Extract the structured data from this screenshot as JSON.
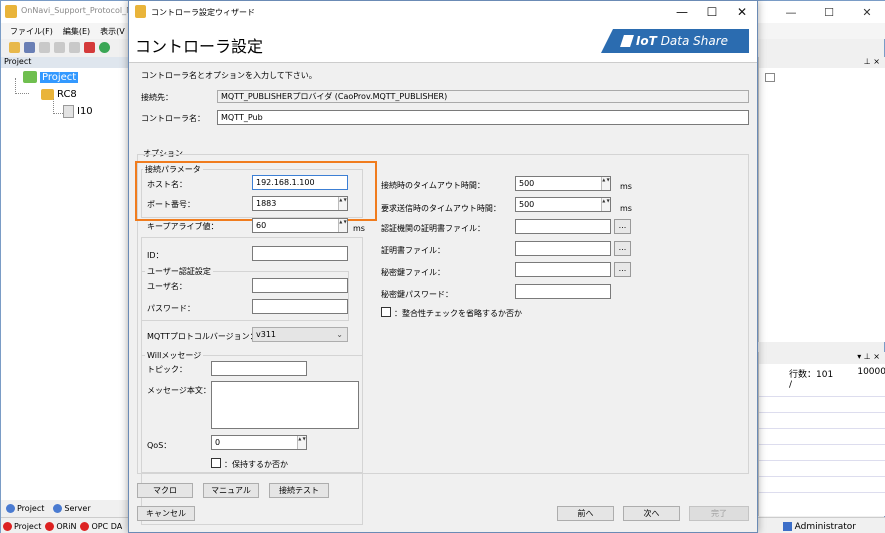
{
  "background_app": {
    "title": "OnNavi_Support_Protocol_M",
    "menu": [
      "ファイル(F)",
      "編集(E)",
      "表示(V"
    ],
    "project_panel_title": "Project",
    "tree": {
      "root": "Project",
      "child": "RC8",
      "grandchild": "I10"
    },
    "bottom_tabs": [
      "Project",
      "Server"
    ],
    "status_items": [
      "Project",
      "ORiN",
      "OPC DA"
    ],
    "admin_label": "Administrator",
    "row_count_label": "行数：101 /",
    "row_count_max": "10000",
    "window_controls": [
      "—",
      "☐",
      "✕"
    ],
    "pin_glyph": "⊥ ×",
    "pin_glyph_bottom": "▾ ⊥ ×"
  },
  "dialog": {
    "title": "コントローラ設定ウィザード",
    "heading": "コントローラ設定",
    "brand": {
      "prefix": "IoT",
      "suffix": "Data Share"
    },
    "window_controls": [
      "—",
      "☐",
      "✕"
    ],
    "instruction": "コントローラ名とオプションを入力して下さい。",
    "connection_label": "接続先：",
    "connection_value": "MQTT_PUBLISHERプロバイダ (CaoProv.MQTT_PUBLISHER)",
    "controller_name_label": "コントローラ名：",
    "controller_name_value": "MQTT_Pub",
    "options_group_title": "オプション",
    "connection_params": {
      "group_title": "接続パラメータ",
      "host_label": "ホスト名：",
      "host_value": "192.168.1.100",
      "port_label": "ポート番号：",
      "port_value": "1883"
    },
    "keepalive_label": "キープアライブ値：",
    "keepalive_value": "60",
    "keepalive_unit": "ms",
    "id_label": "ID：",
    "id_value": "",
    "auth": {
      "group_title": "ユーザー認証設定",
      "user_label": "ユーザ名：",
      "password_label": "パスワード："
    },
    "mqtt_version_label": "MQTTプロトコルバージョン：",
    "mqtt_version_value": "v311",
    "will": {
      "group_title": "Willメッセージ",
      "topic_label": "トピック：",
      "body_label": "メッセージ本文：",
      "qos_label": "QoS：",
      "qos_value": "0",
      "retain_label": "：保持するか否か"
    },
    "right": {
      "conn_timeout_label": "接続時のタイムアウト時間：",
      "conn_timeout_value": "500",
      "conn_timeout_unit": "ms",
      "req_timeout_label": "要求送信時のタイムアウト時間：",
      "req_timeout_value": "500",
      "req_timeout_unit": "ms",
      "ca_cert_label": "認証機関の証明書ファイル：",
      "cert_label": "証明書ファイル：",
      "key_label": "秘密鍵ファイル：",
      "key_password_label": "秘密鍵パスワード：",
      "integrity_label": "：整合性チェックを省略するか否か",
      "browse_label": "..."
    },
    "buttons": {
      "macro": "マクロ",
      "manual": "マニュアル",
      "test": "接続テスト",
      "cancel": "キャンセル",
      "back": "前へ",
      "next": "次へ",
      "finish": "完了"
    },
    "spin_glyph": "▲ ▼",
    "select_chevron": "⌄"
  },
  "colors": {
    "highlight": "#f07c1e",
    "brand": "#2b6cb0",
    "selection": "#3399ff"
  }
}
